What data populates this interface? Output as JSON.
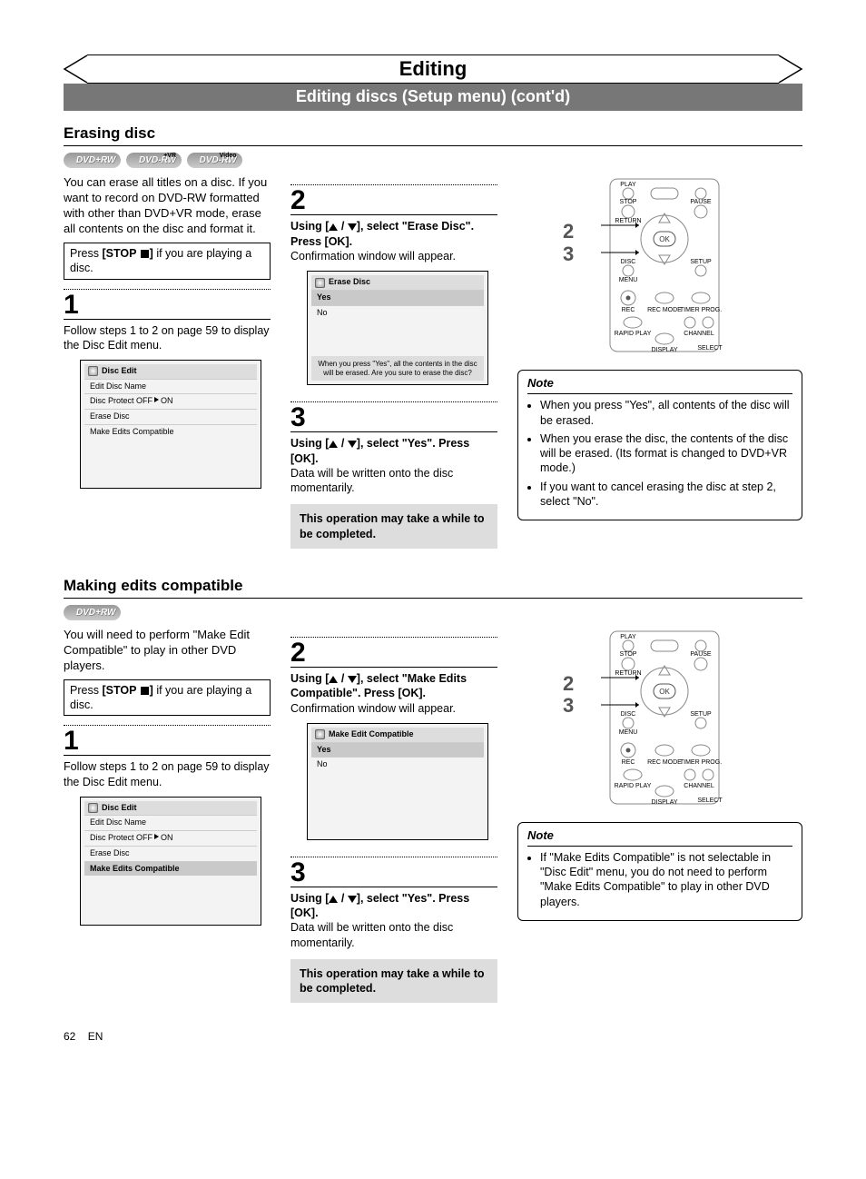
{
  "page_title": "Editing",
  "sub_banner": "Editing discs (Setup menu) (cont'd)",
  "section_erase": {
    "heading": "Erasing disc",
    "badges": [
      "DVD+RW",
      "DVD-RW",
      "DVD-RW"
    ],
    "badge_sups": [
      "",
      "+VR",
      "Video"
    ],
    "intro": "You can erase all titles on a disc. If you want to record on DVD-RW formatted with other than DVD+VR mode, erase all contents on the disc and format it.",
    "press_prefix": "Press ",
    "press_stop": "[STOP ",
    "press_stop_end": "]",
    "press_suffix": " if you are playing a disc.",
    "step1_num": "1",
    "step1_text": "Follow steps 1 to 2 on page 59 to display the Disc Edit menu.",
    "osd1_title": "Disc Edit",
    "osd1_rows": [
      "Edit Disc Name",
      "Disc Protect OFF → ON",
      "Erase Disc",
      "Make Edits Compatible"
    ],
    "step2_num": "2",
    "step2_line_a": "Using [",
    "step2_line_b": " / ",
    "step2_line_c": "], select \"Erase Disc\". Press [OK].",
    "step2_body": "Confirmation window will appear.",
    "osd2_title": "Erase Disc",
    "osd2_rows": [
      "Yes",
      "No"
    ],
    "osd2_msg": "When you press \"Yes\", all the contents in the disc will be erased. Are you sure to erase the disc?",
    "step3_num": "3",
    "step3_line_a": "Using [",
    "step3_line_b": " / ",
    "step3_line_c": "], select \"Yes\". Press [OK].",
    "step3_body": "Data will be written onto the disc momentarily.",
    "grey_note": "This operation may take a while to be completed.",
    "remote_steps": "2\n3",
    "note_title": "Note",
    "notes": [
      "When you press \"Yes\", all contents of the disc will be erased.",
      "When you erase the disc, the contents of the disc will be erased. (Its format is changed to DVD+VR mode.)",
      "If you want to cancel erasing the disc at step 2, select \"No\"."
    ]
  },
  "section_make": {
    "heading": "Making edits compatible",
    "badges": [
      "DVD+RW"
    ],
    "intro": "You will need to perform \"Make Edit Compatible\" to play in other DVD players.",
    "press_prefix": "Press ",
    "press_stop": "[STOP ",
    "press_stop_end": "]",
    "press_suffix": " if you are playing a disc.",
    "step1_num": "1",
    "step1_text": "Follow steps 1 to 2 on page 59 to display the Disc Edit menu.",
    "osd1_title": "Disc Edit",
    "osd1_rows": [
      "Edit Disc Name",
      "Disc Protect OFF → ON",
      "Erase Disc",
      "Make Edits Compatible"
    ],
    "step2_num": "2",
    "step2_line_a": "Using [",
    "step2_line_b": " / ",
    "step2_line_c": "], select \"Make Edits Compatible\". Press [OK].",
    "step2_body": "Confirmation window will appear.",
    "osd2_title": "Make Edit Compatible",
    "osd2_rows": [
      "Yes",
      "No"
    ],
    "step3_num": "3",
    "step3_line_a": "Using [",
    "step3_line_b": " / ",
    "step3_line_c": "], select \"Yes\". Press [OK].",
    "step3_body": "Data will be written onto the disc momentarily.",
    "grey_note": "This operation may take a while to be completed.",
    "remote_steps": "2\n3",
    "note_title": "Note",
    "notes": [
      "If \"Make Edits Compatible\" is not selectable in \"Disc Edit\" menu, you do not need to perform \"Make Edits Compatible\" to play in other DVD players."
    ]
  },
  "footer_page": "62",
  "footer_lang": "EN"
}
